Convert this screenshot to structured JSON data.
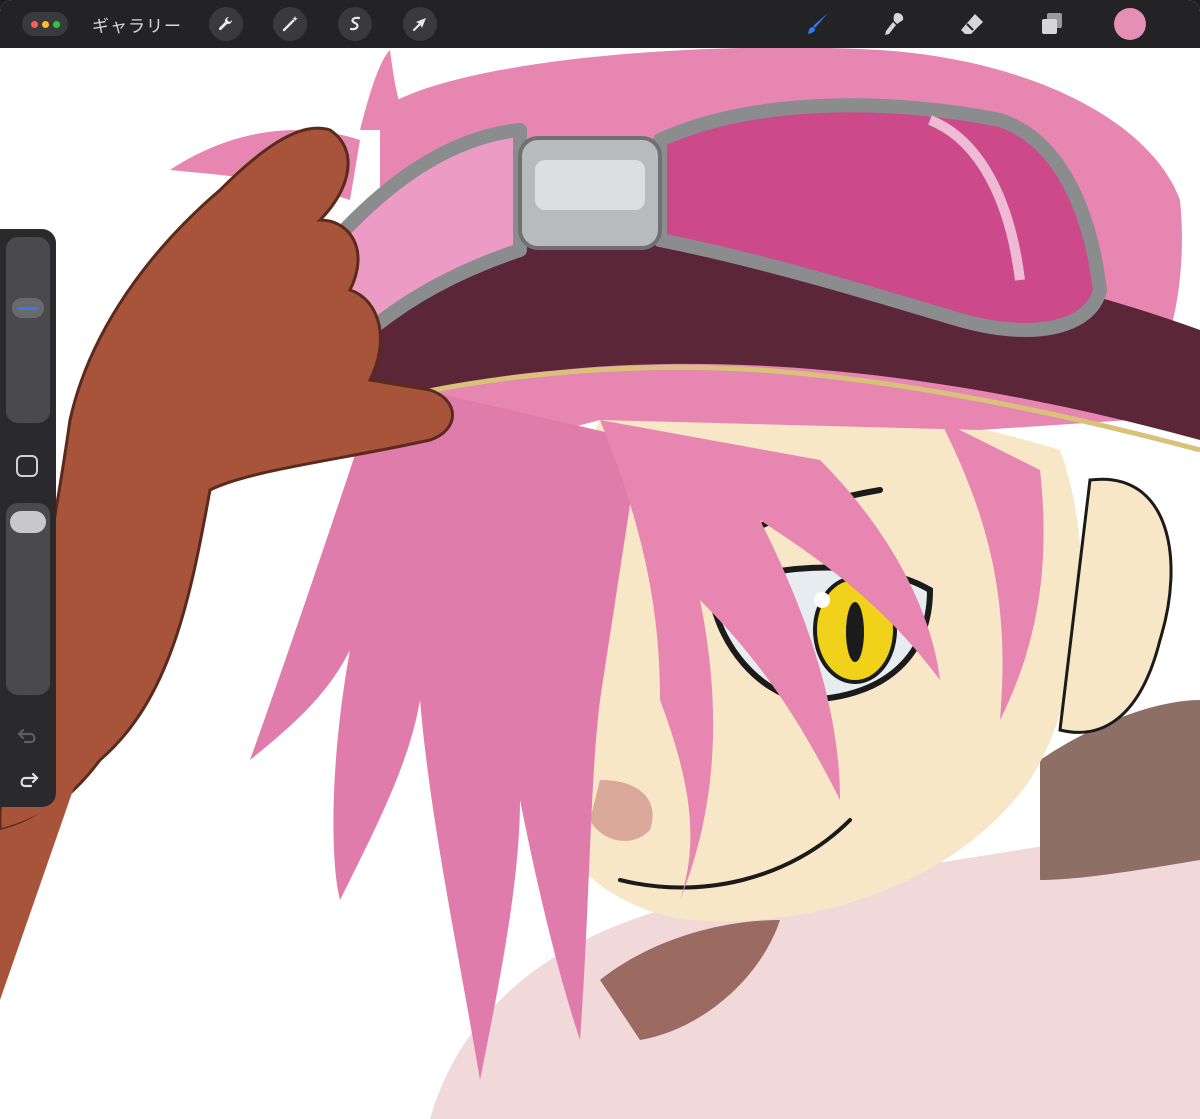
{
  "topbar": {
    "gallery_label": "ギャラリー",
    "window_dots": [
      "#ff5f57",
      "#febc2e",
      "#28c840"
    ],
    "left_tools": [
      "wrench-icon",
      "magic-wand-icon",
      "selection-s-icon",
      "transform-arrow-icon"
    ],
    "right_tools": [
      "brush-icon",
      "smudge-icon",
      "eraser-icon",
      "layers-icon"
    ],
    "active_tool": "brush-icon",
    "current_color": "#e58fb4",
    "accent": "#2f7cf6"
  },
  "sidebar": {
    "brush_size": 0.45,
    "opacity": 1.0,
    "controls": [
      "brush-size-slider",
      "modify-button",
      "opacity-slider",
      "undo-icon",
      "redo-icon"
    ]
  },
  "canvas": {
    "background": "#ffffff",
    "subject": "artwork-layer"
  }
}
